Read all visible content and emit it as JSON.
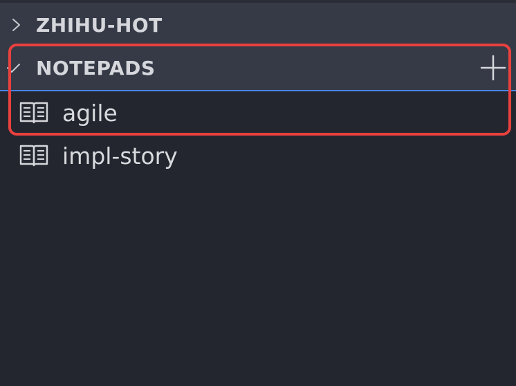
{
  "sections": [
    {
      "title": "ZHIHU-HOT",
      "expanded": false,
      "chevron_icon": "chevron-right-icon"
    },
    {
      "title": "NOTEPADS",
      "expanded": true,
      "chevron_icon": "check-chevron-down-icon",
      "action_icon": "plus-icon",
      "items": [
        {
          "label": "agile",
          "icon": "book-open-icon"
        },
        {
          "label": "impl-story",
          "icon": "book-open-icon"
        }
      ]
    }
  ],
  "colors": {
    "background": "#23262e",
    "header_background": "#353a46",
    "accent_line": "#4a84e8",
    "highlight_border": "#e8413f",
    "text": "#d5d7dc"
  }
}
